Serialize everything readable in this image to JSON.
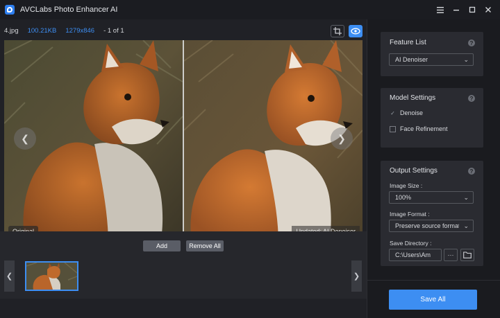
{
  "app": {
    "title": "AVCLabs Photo Enhancer AI"
  },
  "window_controls": [
    "menu-icon",
    "minimize-icon",
    "maximize-icon",
    "close-icon"
  ],
  "file_info": {
    "name": "4.jpg",
    "size": "100.21KB",
    "dimensions": "1279x846",
    "page": "- 1 of 1"
  },
  "preview": {
    "left_label": "Original",
    "right_label": "Updated: AI Denoiser"
  },
  "toolbar_icons": [
    "split-view-icon",
    "compare-icon",
    "fit-icon",
    "zoom-in-icon",
    "zoom-out-icon",
    "crop-icon",
    "save-icon",
    "delete-icon",
    "arrow-left-icon",
    "arrow-right-icon",
    "rotate-icon"
  ],
  "actions": {
    "add": "Add",
    "remove_all": "Remove All"
  },
  "feature_list": {
    "title": "Feature List",
    "selected": "AI Denoiser"
  },
  "model_settings": {
    "title": "Model Settings",
    "options": [
      {
        "label": "Denoise",
        "checked": true
      },
      {
        "label": "Face Refinement",
        "checked": false
      }
    ]
  },
  "output_settings": {
    "title": "Output Settings",
    "image_size_label": "Image Size :",
    "image_size": "100%",
    "image_format_label": "Image Format :",
    "image_format": "Preserve source format",
    "save_directory_label": "Save Directory :",
    "save_directory": "C:\\Users\\Am",
    "more_button": "···"
  },
  "save_all": "Save All",
  "colors": {
    "accent": "#3d8ef2",
    "panel": "#2a2b31",
    "background": "#1c1d22"
  }
}
